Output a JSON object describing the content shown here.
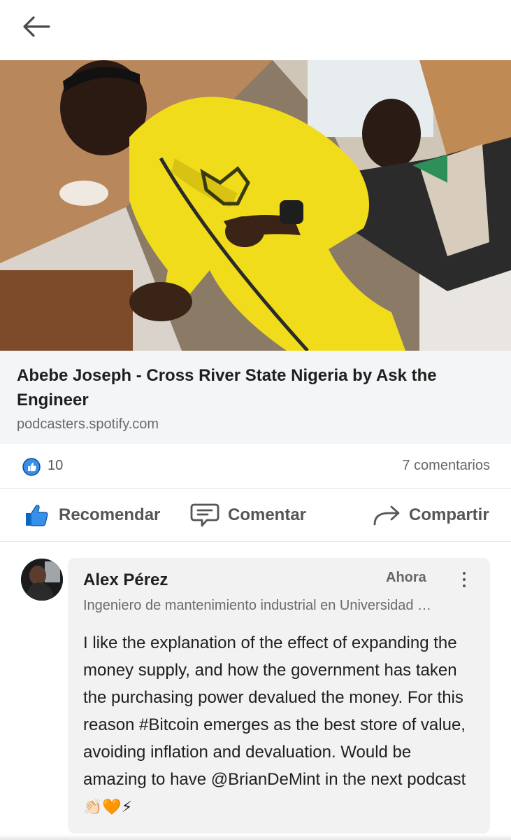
{
  "topbar": {
    "back_icon": "arrow-left-icon"
  },
  "link_card": {
    "title": "Abebe Joseph - Cross River State Nigeria by Ask the Engineer",
    "domain": "podcasters.spotify.com"
  },
  "stats": {
    "likes": "10",
    "comments": "7 comentarios",
    "like_badge_icon": "thumbs-up-badge-icon"
  },
  "actions": {
    "recommend": "Recomendar",
    "comment": "Comentar",
    "share": "Compartir"
  },
  "comment": {
    "author": "Alex Pérez",
    "time": "Ahora",
    "headline": "Ingeniero de mantenimiento industrial en Universidad …",
    "text": "I like the explanation of the effect of expanding the money supply, and how the government has taken the purchasing power devalued the money. For this reason #Bitcoin emerges as the best store of value, avoiding inflation and devaluation. Would be amazing to have @BrianDeMint in the next podcast",
    "emojis": "👏🏻🧡⚡"
  },
  "colors": {
    "accent": "#0a66c2",
    "jacket_yellow": "#f2dd1c",
    "background": "#ffffff",
    "bubble": "#f2f2f2"
  }
}
